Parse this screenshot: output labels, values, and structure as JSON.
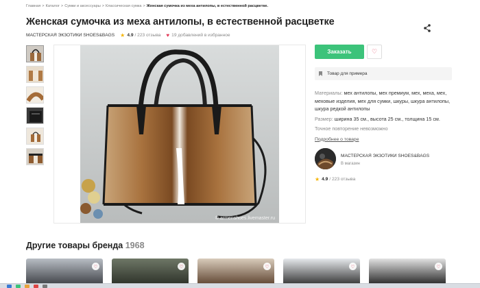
{
  "breadcrumb": [
    "Главная",
    "Каталог",
    "Сумки и аксессуары",
    "Классическая сумка",
    "Женская сумочка из меха антилопы, в естественной расцветке."
  ],
  "product": {
    "title": "Женская сумочка из меха антилопы, в естественной расцветке",
    "shop_name": "МАСТЕРСКАЯ ЭКЗОТИКИ SHOES&BAGS",
    "rating": "4.9",
    "reviews": "/ 223 отзыва",
    "favorites": "19 добавлений в избранное",
    "watermark": "© armenshoes.livemaster.ru"
  },
  "actions": {
    "order_label": "Заказать",
    "sample_label": "Товар для примера"
  },
  "details": {
    "materials_label": "Материалы:",
    "materials_value": "мех антилопы, мех премиум, мех, мехa, мех, меховые изделия, мех для сумки, шкуры, шкура антилопы, шкура редкой антилопы",
    "size_label": "Размер:",
    "size_value": "ширина 35 см., высота 25 см., толщина 15 см.",
    "exact_copy": "Точное повторение невозможно",
    "more_link": "Подробнее о товаре"
  },
  "seller": {
    "name": "МАСТЕРСКАЯ ЭКЗОТИКИ SHOES&BAGS",
    "status": "В магазин",
    "rating": "4.9",
    "reviews": "/ 223 отзыва"
  },
  "other": {
    "title": "Другие товары бренда",
    "count": "1968"
  },
  "icons": {
    "share": "share-icon",
    "star": "star-icon",
    "heart": "heart-icon",
    "bookmark": "bookmark-icon"
  },
  "colors": {
    "accent_green": "#3cc37a",
    "heart_red": "#e23a57",
    "star_yellow": "#f5b400"
  }
}
